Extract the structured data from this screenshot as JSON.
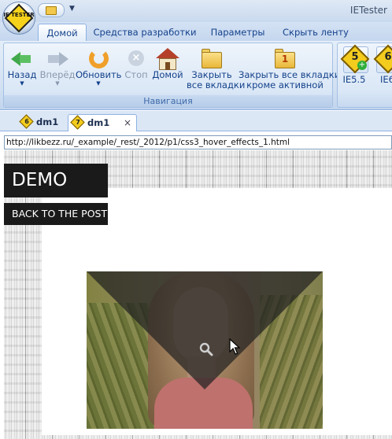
{
  "app": {
    "title": "IETester"
  },
  "orb": {
    "text": "IE TESTER"
  },
  "ribbon": {
    "tabs": [
      {
        "label": "Домой",
        "active": true
      },
      {
        "label": "Средства разработки",
        "active": false
      },
      {
        "label": "Параметры",
        "active": false
      },
      {
        "label": "Скрыть ленту",
        "active": false
      }
    ],
    "navigation": {
      "group_label": "Навигация",
      "back": "Назад",
      "forward": "Вперёд",
      "refresh": "Обновить",
      "stop": "Стоп",
      "home": "Домой",
      "close_all_1": "Закрыть",
      "close_all_2": "все вкладки",
      "close_others_1": "Закрыть все вкладки,",
      "close_others_2": "кроме активной",
      "close_others_badge": "1"
    },
    "versions": {
      "ie55": {
        "label": "IE5.5",
        "badge": "5"
      },
      "ie6": {
        "label": "IE6",
        "badge": "6"
      }
    }
  },
  "doc_tabs": [
    {
      "label": "dm1",
      "version": "6",
      "active": false
    },
    {
      "label": "dm1",
      "version": "7",
      "active": true,
      "close": "×"
    }
  ],
  "address": {
    "url": "http://likbezz.ru/_example/_rest/_2012/p1/css3_hover_effects_1.html"
  },
  "page": {
    "demo_title": "DEMO",
    "back_link": "BACK TO THE POST"
  },
  "colors": {
    "ribbon_text": "#15428b",
    "demo_bg": "#1a1a1a",
    "overlay_triangle": "#232323"
  },
  "icons": [
    "back-arrow-icon",
    "forward-arrow-icon",
    "refresh-icon",
    "stop-icon",
    "home-icon",
    "folder-icon",
    "folder-one-icon",
    "ie55-icon",
    "ie6-icon",
    "magnify-icon",
    "cursor-icon"
  ]
}
